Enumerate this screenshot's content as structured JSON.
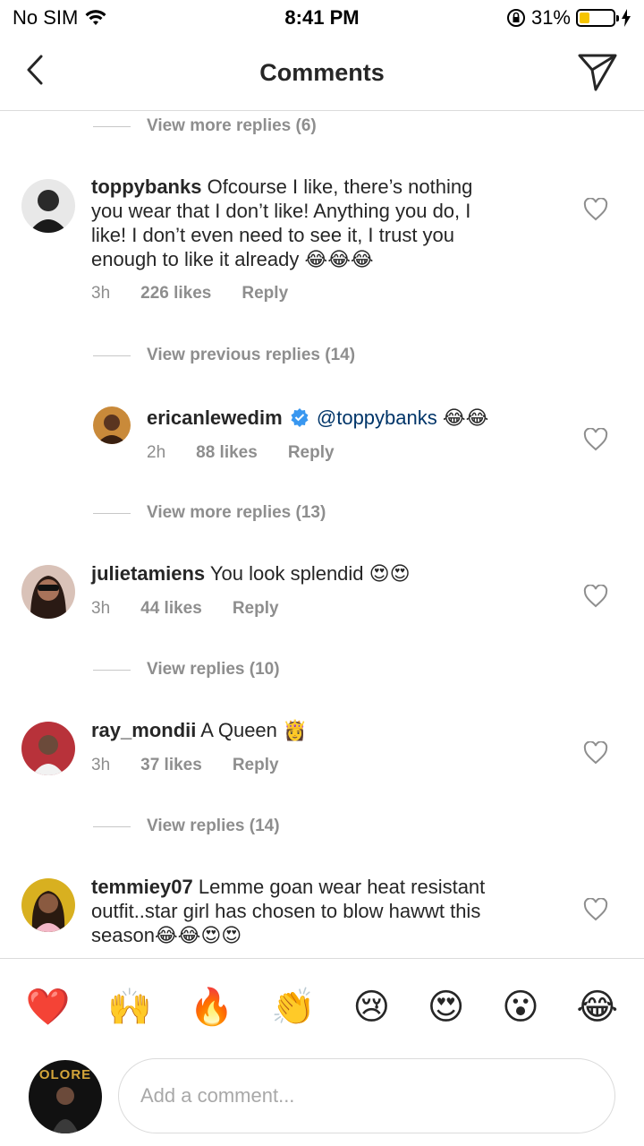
{
  "status": {
    "carrier": "No SIM",
    "time": "8:41 PM",
    "battery": "31%",
    "battery_level": 0.31
  },
  "nav": {
    "title": "Comments"
  },
  "threads": {
    "more_replies_top": "View more replies (6)",
    "prev_replies": "View previous replies (14)",
    "more_replies_mid": "View more replies (13)",
    "replies_10": "View replies (10)",
    "replies_14": "View replies (14)"
  },
  "comments": [
    {
      "user": "toppybanks",
      "text_lines": [
        "Ofcourse I like, there’s nothing",
        "you wear that I don’t like! Anything you do, I",
        "like! I don’t even need to see it, I trust you",
        "enough to like it already 😂😂😂"
      ],
      "time": "3h",
      "likes": "226 likes",
      "reply": "Reply"
    },
    {
      "user": "ericanlewedim",
      "mention": "@toppybanks",
      "text": "😂😂",
      "time": "2h",
      "likes": "88 likes",
      "reply": "Reply"
    },
    {
      "user": "julietamiens",
      "text": "You look splendid 😍😍",
      "time": "3h",
      "likes": "44 likes",
      "reply": "Reply"
    },
    {
      "user": "ray_mondii",
      "text": "A Queen 👸",
      "time": "3h",
      "likes": "37 likes",
      "reply": "Reply"
    },
    {
      "user": "temmiey07",
      "text_lines": [
        "Lemme goan wear heat resistant",
        "outfit..star girl has chosen to blow hawwt this",
        "season😂😂😍😍"
      ]
    }
  ],
  "emoji_bar": [
    "❤️",
    "🙌",
    "🔥",
    "👏",
    "😢",
    "😍",
    "😮",
    "😂"
  ],
  "composer": {
    "placeholder": "Add a comment...",
    "avatar_text": "OLORE"
  },
  "colors": {
    "accent": "#3897f0",
    "mention": "#003569",
    "muted": "#8e8e8e"
  }
}
